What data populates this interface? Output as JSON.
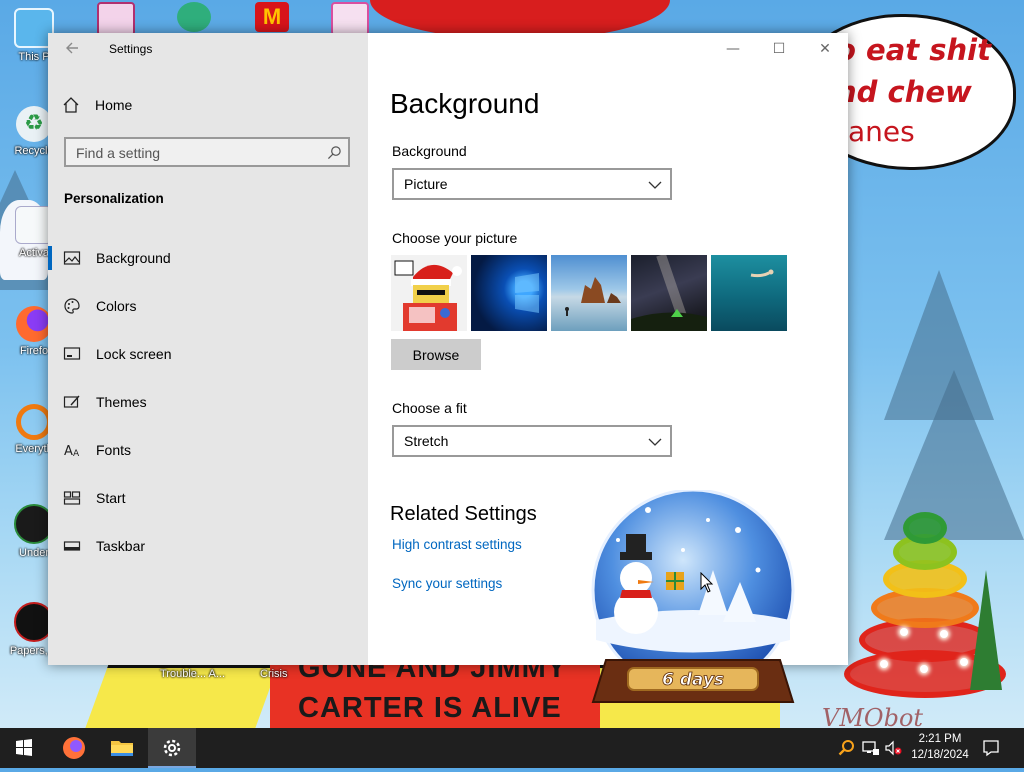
{
  "colors": {
    "accent": "#0067c0",
    "nav_background": "#e6e6e6",
    "taskbar": "#1f1f1f",
    "link": "#0067c0"
  },
  "wallpaper": {
    "speech_lines": [
      "o eat shit",
      "nd chew",
      "anes"
    ],
    "banner_lines": [
      "GONE AND JIMMY",
      "CARTER IS ALIVE"
    ],
    "globe_text": "6 days",
    "watermark": "VMObot"
  },
  "desktop": {
    "icons": [
      {
        "label": "This P",
        "icon": "this-pc-icon"
      },
      {
        "label": "Recycle",
        "icon": "recycle-bin-icon"
      },
      {
        "label": "Activa",
        "icon": "activate-icon"
      },
      {
        "label": "Firefo",
        "icon": "firefox-icon"
      },
      {
        "label": "Everyth",
        "icon": "everything-search-icon"
      },
      {
        "label": "Under",
        "icon": "undertale-icon"
      },
      {
        "label": "Papers, P",
        "icon": "papers-please-icon"
      }
    ],
    "cropped_labels": [
      "Trouble... A...",
      "Crisis"
    ]
  },
  "window": {
    "title": "Settings",
    "back_icon": "back-arrow-icon",
    "controls": {
      "minimize": "—",
      "maximize": "☐",
      "close": "✕"
    }
  },
  "nav": {
    "home_label": "Home",
    "search_placeholder": "Find a setting",
    "section": "Personalization",
    "items": [
      {
        "label": "Background",
        "icon": "background-icon",
        "selected": true
      },
      {
        "label": "Colors",
        "icon": "palette-icon",
        "selected": false
      },
      {
        "label": "Lock screen",
        "icon": "lock-screen-icon",
        "selected": false
      },
      {
        "label": "Themes",
        "icon": "themes-icon",
        "selected": false
      },
      {
        "label": "Fonts",
        "icon": "fonts-icon",
        "selected": false
      },
      {
        "label": "Start",
        "icon": "start-icon",
        "selected": false
      },
      {
        "label": "Taskbar",
        "icon": "taskbar-icon",
        "selected": false
      }
    ]
  },
  "content": {
    "page_title": "Background",
    "background_label": "Background",
    "background_value": "Picture",
    "choose_picture_label": "Choose your picture",
    "pictures": [
      "custom-santa-picture",
      "windows-10-hero",
      "beach-rocks",
      "night-sky-tent",
      "underwater-swimmer"
    ],
    "browse_label": "Browse",
    "fit_label": "Choose a fit",
    "fit_value": "Stretch",
    "related_title": "Related Settings",
    "links": [
      "High contrast settings",
      "Sync your settings"
    ]
  },
  "taskbar": {
    "apps": [
      "windows-start-icon",
      "firefox-icon",
      "file-explorer-icon",
      "settings-gear-icon"
    ],
    "time": "2:21 PM",
    "date": "12/18/2024"
  }
}
